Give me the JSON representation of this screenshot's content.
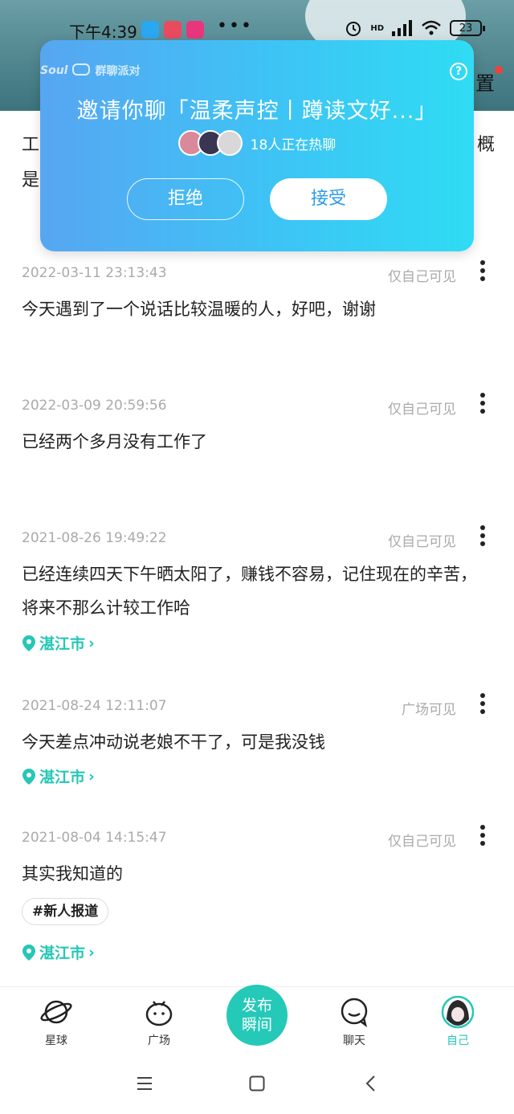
{
  "status_bar": {
    "time": "下午4:39",
    "dots": "•••",
    "battery": "23",
    "signal_label": "HD"
  },
  "background": {
    "settings_label": "置",
    "partial_lines": [
      "工",
      "是",
      "概"
    ]
  },
  "invite": {
    "brand": "群聊派对",
    "brand_logo": "Soul",
    "title": "邀请你聊「温柔声控丨蹲读文好...」",
    "online_count": "18人正在热聊",
    "reject_label": "拒绝",
    "accept_label": "接受",
    "help_icon": "question-circle-icon"
  },
  "posts": [
    {
      "date": "2022-03-11 23:13:43",
      "visibility": "仅自己可见",
      "text": "今天遇到了一个说话比较温暖的人，好吧，谢谢"
    },
    {
      "date": "2022-03-09 20:59:56",
      "visibility": "仅自己可见",
      "text": "已经两个多月没有工作了"
    },
    {
      "date": "2021-08-26 19:49:22",
      "visibility": "仅自己可见",
      "text": "已经连续四天下午晒太阳了，赚钱不容易，记住现在的辛苦，将来不那么计较工作哈",
      "location": "湛江市"
    },
    {
      "date": "2021-08-24 12:11:07",
      "visibility": "广场可见",
      "text": "今天差点冲动说老娘不干了，可是我没钱",
      "location": "湛江市"
    },
    {
      "date": "2021-08-04 14:15:47",
      "visibility": "仅自己可见",
      "text": "其实我知道的",
      "tag": "#新人报道",
      "location": "湛江市"
    }
  ],
  "bottom_nav": {
    "items": [
      "星球",
      "广场",
      "聊天",
      "自己"
    ],
    "publish_label": "发布瞬间",
    "active": "自己",
    "accent": "#25c7b6"
  }
}
